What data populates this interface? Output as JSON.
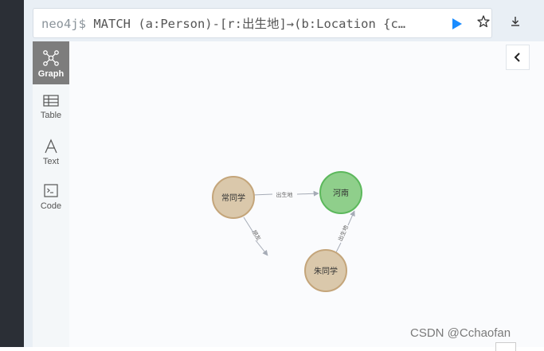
{
  "query": {
    "prompt": "neo4j$",
    "text": " MATCH (a:Person)-[r:出生地]→(b:Location {c…"
  },
  "toolbar": {
    "items": [
      {
        "label": "Graph",
        "icon": "graph-icon",
        "active": true
      },
      {
        "label": "Table",
        "icon": "table-icon",
        "active": false
      },
      {
        "label": "Text",
        "icon": "text-icon",
        "active": false
      },
      {
        "label": "Code",
        "icon": "code-icon",
        "active": false
      }
    ]
  },
  "graph": {
    "nodes": [
      {
        "id": "n1",
        "label": "常同学",
        "color": "#dac8ab",
        "stroke": "#c4a57a"
      },
      {
        "id": "n2",
        "label": "河南",
        "color": "#8fcf8b",
        "stroke": "#5cb85c"
      },
      {
        "id": "n3",
        "label": "朱同学",
        "color": "#dac8ab",
        "stroke": "#c4a57a"
      }
    ],
    "relationships": [
      {
        "from": "n1",
        "to": "n2",
        "label": "出生地"
      },
      {
        "from": "n1",
        "to": "n3",
        "label": "朋友"
      },
      {
        "from": "n3",
        "to": "n2",
        "label": "出生地"
      }
    ]
  },
  "watermark": "CSDN @Cchaofan",
  "colors": {
    "accent": "#1a8cff",
    "sidebar_dark": "#2b2f36"
  }
}
